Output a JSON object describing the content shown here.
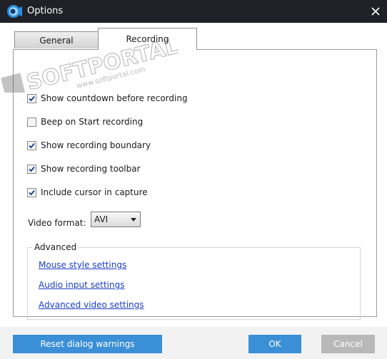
{
  "window": {
    "title": "Options"
  },
  "tabs": [
    {
      "label": "General",
      "active": false
    },
    {
      "label": "Recording",
      "active": true
    }
  ],
  "recording": {
    "options": [
      {
        "label": "Show countdown before recording",
        "checked": true
      },
      {
        "label": "Beep on Start recording",
        "checked": false
      },
      {
        "label": "Show recording boundary",
        "checked": true
      },
      {
        "label": "Show recording toolbar",
        "checked": true
      },
      {
        "label": "Include cursor in capture",
        "checked": true
      }
    ],
    "video_format": {
      "label": "Video format:",
      "selected": "AVI"
    },
    "advanced": {
      "title": "Advanced",
      "links": [
        {
          "label": "Mouse style settings"
        },
        {
          "label": "Audio input settings"
        },
        {
          "label": "Advanced video settings"
        }
      ]
    }
  },
  "footer": {
    "reset_label": "Reset dialog warnings",
    "ok_label": "OK",
    "cancel_label": "Cancel"
  },
  "watermark": {
    "text": "SOFTPORTAL",
    "sub": "www.softportal.com"
  },
  "colors": {
    "titlebar": "#1f2127",
    "accent": "#3a8fd6",
    "link": "#1a3cc8",
    "cancel": "#b8b8b8"
  }
}
